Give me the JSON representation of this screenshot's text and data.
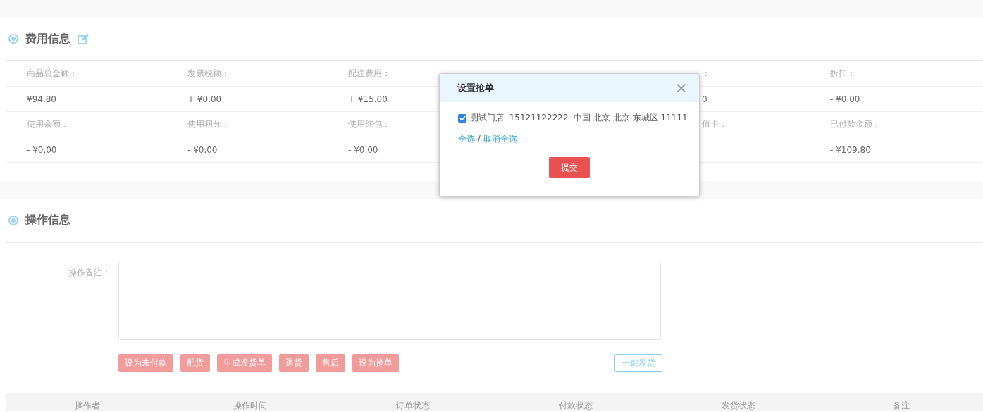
{
  "fee_section": {
    "title": "费用信息",
    "rows": [
      {
        "kind": "label",
        "cells": [
          "商品总金额：",
          "发票税额：",
          "配送费用：",
          null,
          "：",
          "折扣："
        ]
      },
      {
        "kind": "value",
        "cells": [
          "¥94.80",
          "+ ¥0.00",
          "+ ¥15.00",
          null,
          "0",
          "- ¥0.00"
        ]
      },
      {
        "kind": "label",
        "cells": [
          "使用余额：",
          "使用积分：",
          "使用红包：",
          null,
          "值卡：",
          "已付款金额："
        ]
      },
      {
        "kind": "value",
        "cells": [
          "- ¥0.00",
          "- ¥0.00",
          "- ¥0.00",
          null,
          null,
          "- ¥109.80"
        ]
      }
    ]
  },
  "operation_section": {
    "title": "操作信息",
    "remark_label": "操作备注：",
    "actions": [
      "设为未付款",
      "配货",
      "生成发货单",
      "退货",
      "售后",
      "设为抢单"
    ],
    "ship_button": "一键发货",
    "log_columns": [
      "操作者",
      "操作时间",
      "订单状态",
      "付款状态",
      "发货状态",
      "备注"
    ]
  },
  "dialog": {
    "title": "设置抢单",
    "close": "×",
    "stores": [
      {
        "text": "测试门店  15121122222  中国 北京 北京 东城区 11111",
        "checked": true
      }
    ],
    "select_all": "全选",
    "separator": "/",
    "deselect_all": "取消全选",
    "submit": "提交"
  }
}
